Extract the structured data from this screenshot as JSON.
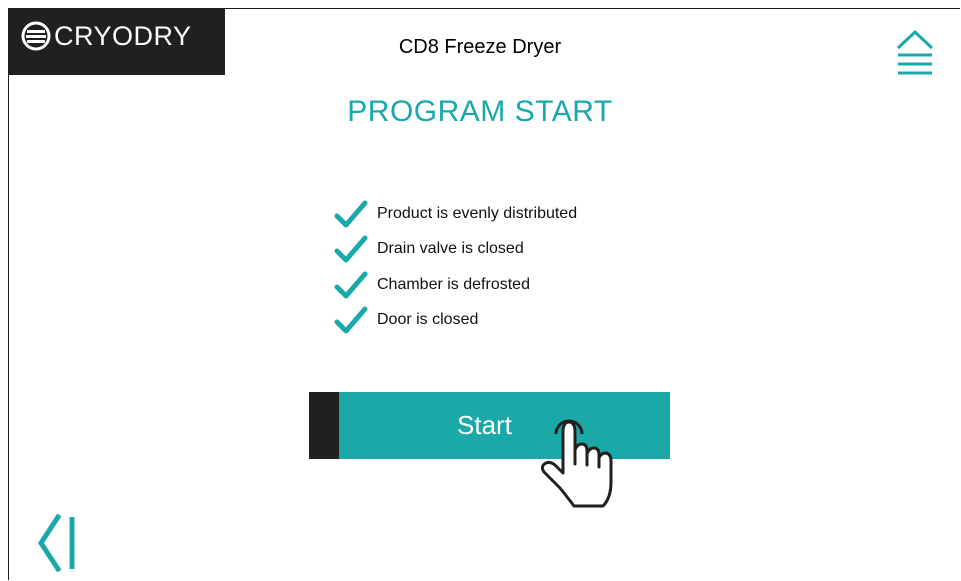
{
  "brand": {
    "logo_text": "CRYODRY"
  },
  "header": {
    "title": "CD8 Freeze Dryer",
    "menu_icon": "eject-menu-icon"
  },
  "main": {
    "heading": "PROGRAM START",
    "checklist": [
      {
        "label": "Product is evenly distributed",
        "icon": "checkmark-icon"
      },
      {
        "label": "Drain valve is closed",
        "icon": "checkmark-icon"
      },
      {
        "label": "Chamber is defrosted",
        "icon": "checkmark-icon"
      },
      {
        "label": "Door is closed",
        "icon": "checkmark-icon"
      }
    ],
    "start_label": "Start",
    "start_hint_icon": "tap-hand-icon"
  },
  "footer": {
    "back_icon": "back-arrow-icon"
  },
  "colors": {
    "accent": "#1aa9a6",
    "dark": "#221f20",
    "heading": "#19a9ab"
  }
}
